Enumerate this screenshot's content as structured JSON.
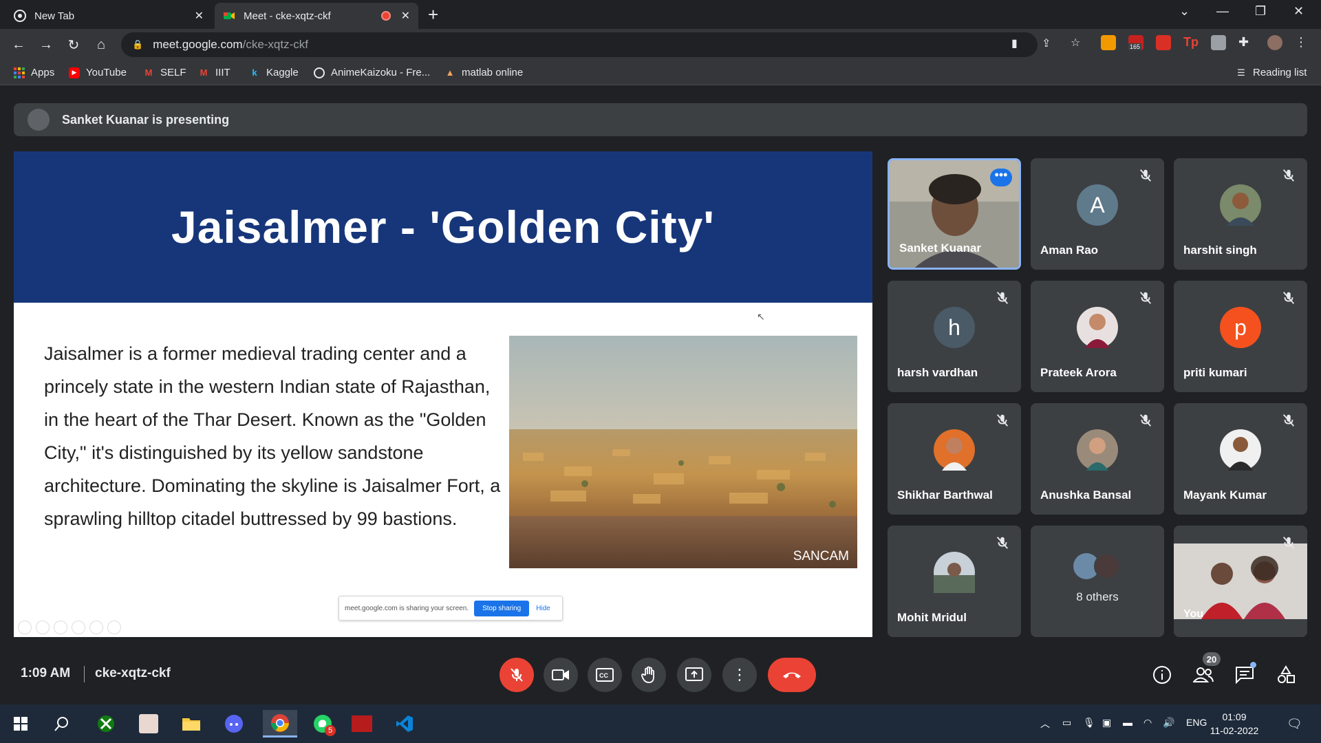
{
  "browser": {
    "tabs": [
      {
        "title": "New Tab",
        "active": false
      },
      {
        "title": "Meet - cke-xqtz-ckf",
        "active": true
      }
    ],
    "url_host": "meet.google.com",
    "url_path": "/cke-xqtz-ckf",
    "bookmarks": [
      "Apps",
      "YouTube",
      "SELF",
      "IIIT",
      "Kaggle",
      "AnimeKaizoku - Fre...",
      "matlab online"
    ],
    "reading_list": "Reading list",
    "extension_badge": "165"
  },
  "meet": {
    "presenting_banner": "Sanket Kuanar is presenting",
    "slide": {
      "title": "Jaisalmer - 'Golden City'",
      "body": "Jaisalmer is a former medieval trading center and a princely state in the western Indian state of Rajasthan, in the heart of the Thar Desert. Known as the \"Golden City,\" it's distinguished by its yellow sandstone architecture. Dominating the skyline is Jaisalmer Fort, a sprawling hilltop citadel buttressed by 99 bastions.",
      "photo_caption": "SANCAM",
      "share_notice": "meet.google.com is sharing your screen.",
      "stop_sharing": "Stop sharing",
      "hide": "Hide"
    },
    "participants": [
      {
        "name": "Sanket Kuanar",
        "kind": "video"
      },
      {
        "name": "Aman Rao",
        "initial": "A",
        "color": "#5f7a8a"
      },
      {
        "name": "harshit singh",
        "kind": "photo"
      },
      {
        "name": "harsh vardhan",
        "initial": "h",
        "color": "#4a5a66"
      },
      {
        "name": "Prateek Arora",
        "kind": "photo"
      },
      {
        "name": "priti kumari",
        "initial": "p",
        "color": "#f4511e"
      },
      {
        "name": "Shikhar Barthwal",
        "kind": "photo"
      },
      {
        "name": "Anushka Bansal",
        "kind": "photo"
      },
      {
        "name": "Mayank Kumar",
        "kind": "photo"
      },
      {
        "name": "Mohit Mridul",
        "kind": "photo"
      },
      {
        "name": "8 others",
        "kind": "group"
      },
      {
        "name": "You",
        "kind": "video"
      }
    ],
    "time": "1:09 AM",
    "meeting_code": "cke-xqtz-ckf",
    "people_count": "20"
  },
  "taskbar": {
    "language": "ENG",
    "time": "01:09",
    "date": "11-02-2022",
    "whatsapp_badge": "5"
  },
  "colors": {
    "accent_blue": "#8ab4f8",
    "end_call_red": "#ea4335",
    "slide_header": "#17367a"
  }
}
